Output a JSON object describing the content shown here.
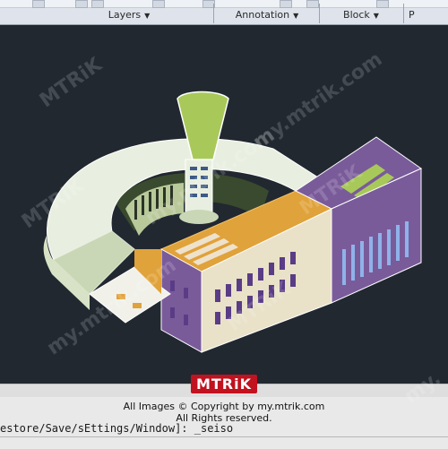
{
  "ribbon": {
    "panels": [
      "Layers",
      "Annotation",
      "Block",
      "P"
    ]
  },
  "command_line": {
    "text": "estore/Save/sEttings/Window]: _seiso"
  },
  "watermark": {
    "logo_text": "MTRiK",
    "copyright": "All Images © Copyright by my.mtrik.com",
    "rights": "All Rights reserved.",
    "tiles": [
      "MTRiK",
      "my.mtrik.com",
      "MTRiK",
      "my.mtrik.com",
      "MTRiK",
      "MTRiK",
      "my.mtrik.com",
      "my."
    ]
  },
  "colors": {
    "viewport_bg": "#212830",
    "wall_purple": "#7a5b9a",
    "roof_orange": "#e0a23a",
    "green": "#a8c95a",
    "ring_white": "#e9efe0",
    "window_blue": "#8fb2ea"
  }
}
